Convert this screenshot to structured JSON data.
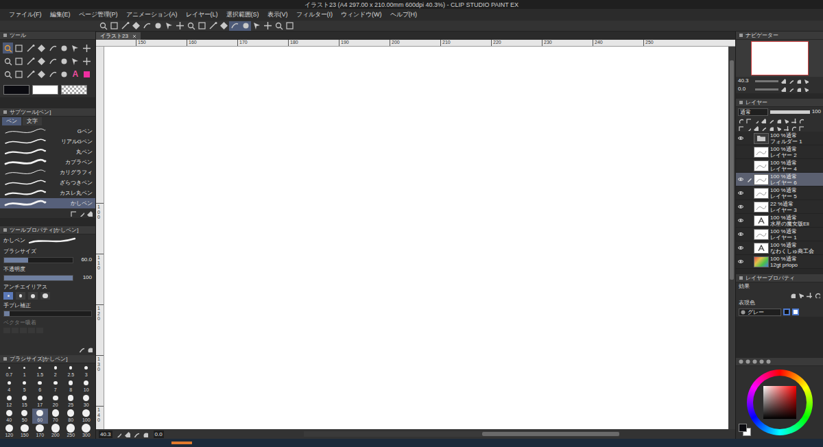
{
  "window": {
    "title": "イラスト23 (A4 297.00 x 210.00mm 600dpi 40.3%) - CLIP STUDIO PAINT EX"
  },
  "menu": [
    "ファイル(F)",
    "編集(E)",
    "ページ管理(P)",
    "アニメーション(A)",
    "レイヤー(L)",
    "選択範囲(S)",
    "表示(V)",
    "フィルター(I)",
    "ウィンドウ(W)",
    "ヘルプ(H)"
  ],
  "tool_palette": {
    "title": "ツール",
    "text_tool": "A"
  },
  "swatches": [
    {
      "kind": "main",
      "color": "#0b0b10"
    },
    {
      "kind": "sub",
      "color": "#ffffff"
    },
    {
      "kind": "transparent"
    }
  ],
  "sub_tool": {
    "title": "サブツール[ペン]",
    "tabs": [
      {
        "label": "ペン",
        "selected": true
      },
      {
        "label": "文字",
        "selected": false
      }
    ],
    "items": [
      {
        "label": "Gペン",
        "selected": false
      },
      {
        "label": "リアルGペン",
        "selected": false
      },
      {
        "label": "丸ペン",
        "selected": false
      },
      {
        "label": "カブラペン",
        "selected": false
      },
      {
        "label": "カリグラフィ",
        "selected": false
      },
      {
        "label": "ざらつきペン",
        "selected": false
      },
      {
        "label": "カスレ丸ペン",
        "selected": false
      },
      {
        "label": "かしペン",
        "selected": true
      }
    ]
  },
  "tool_property": {
    "title": "ツールプロパティ[かしペン]",
    "brush": "かしペン",
    "rows": [
      {
        "kind": "slider",
        "label": "ブラシサイズ",
        "value": "60.0",
        "level": 0.35
      },
      {
        "kind": "slider",
        "label": "不透明度",
        "value": "100",
        "level": 1
      },
      {
        "kind": "choice",
        "label": "アンチエイリアス",
        "options": [
          {
            "selected": true
          },
          {
            "selected": false
          },
          {
            "selected": false
          },
          {
            "selected": false
          }
        ]
      },
      {
        "kind": "bar",
        "label": "手ブレ補正",
        "level": 0.06
      },
      {
        "kind": "toggle",
        "label": "ベクター吸着",
        "disabled": true
      }
    ]
  },
  "brush_size": {
    "title": "ブラシサイズ[かしペン]",
    "sizes": [
      {
        "label": "0.7",
        "selected": false
      },
      {
        "label": "1",
        "selected": false
      },
      {
        "label": "1.5",
        "selected": false
      },
      {
        "label": "2",
        "selected": false
      },
      {
        "label": "2.5",
        "selected": false
      },
      {
        "label": "3",
        "selected": false
      },
      {
        "label": "4",
        "selected": false
      },
      {
        "label": "5",
        "selected": false
      },
      {
        "label": "6",
        "selected": false
      },
      {
        "label": "7",
        "selected": false
      },
      {
        "label": "8",
        "selected": false
      },
      {
        "label": "10",
        "selected": false
      },
      {
        "label": "12",
        "selected": false
      },
      {
        "label": "15",
        "selected": false
      },
      {
        "label": "17",
        "selected": false
      },
      {
        "label": "20",
        "selected": false
      },
      {
        "label": "25",
        "selected": false
      },
      {
        "label": "30",
        "selected": false
      },
      {
        "label": "40",
        "selected": false
      },
      {
        "label": "50",
        "selected": false
      },
      {
        "label": "60",
        "selected": true
      },
      {
        "label": "70",
        "selected": false
      },
      {
        "label": "80",
        "selected": false
      },
      {
        "label": "100",
        "selected": false
      },
      {
        "label": "120",
        "selected": false
      },
      {
        "label": "150",
        "selected": false
      },
      {
        "label": "170",
        "selected": false
      },
      {
        "label": "200",
        "selected": false
      },
      {
        "label": "250",
        "selected": false
      },
      {
        "label": "300",
        "selected": false
      }
    ]
  },
  "document": {
    "tab": "イラスト23"
  },
  "ruler": {
    "top": [
      "150",
      "160",
      "170",
      "180",
      "190",
      "200",
      "210",
      "220",
      "230",
      "240",
      "250"
    ],
    "left": [
      "100",
      "110",
      "120",
      "130",
      "140"
    ]
  },
  "canvas_status": {
    "zoom": "40.3",
    "angle": "0.0"
  },
  "navigator": {
    "title": "ナビゲーター",
    "zoom": "40.3",
    "angle": "0.0"
  },
  "layers": {
    "title": "レイヤー",
    "blend": "通常",
    "opacity": "100",
    "items": [
      {
        "mode": "100 %通常",
        "name": "フォルダー 1",
        "kind": "folder",
        "visible": true,
        "selected": false
      },
      {
        "mode": "100 %通常",
        "name": "レイヤー 2",
        "kind": "raster",
        "visible": false,
        "selected": false
      },
      {
        "mode": "100 %通常",
        "name": "レイヤー 4",
        "kind": "raster",
        "visible": false,
        "selected": false
      },
      {
        "mode": "100 %通常",
        "name": "レイヤー 6",
        "kind": "raster",
        "visible": true,
        "selected": true
      },
      {
        "mode": "100 %通常",
        "name": "レイヤー 5",
        "kind": "raster",
        "visible": true,
        "selected": false
      },
      {
        "mode": "22 %通常",
        "name": "レイヤー 3",
        "kind": "raster",
        "visible": true,
        "selected": false
      },
      {
        "mode": "100 %通常",
        "name": "水星の魔女版Eli",
        "kind": "text",
        "visible": true,
        "selected": false
      },
      {
        "mode": "100 %通常",
        "name": "レイヤー 1",
        "kind": "raster",
        "visible": true,
        "selected": false
      },
      {
        "mode": "100 %通常",
        "name": "なわくしゅ商工会",
        "kind": "text",
        "visible": true,
        "selected": false
      },
      {
        "mode": "100 %通常",
        "name": "12gt prlopo",
        "kind": "fill",
        "visible": true,
        "selected": false
      }
    ]
  },
  "layer_property": {
    "title": "レイヤープロパティ",
    "effect_label": "効果",
    "color_label": "表現色",
    "color_value": "グレー"
  }
}
